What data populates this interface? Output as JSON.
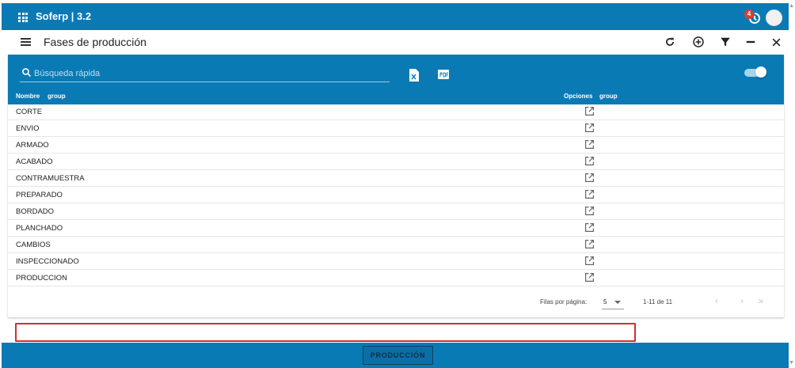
{
  "app": {
    "title": "Soferp | 3.2",
    "notification_count": "4",
    "accent_color": "#0a7ab5"
  },
  "header": {
    "title": "Fases de producción"
  },
  "toolbar": {
    "search_placeholder": "Búsqueda rápida",
    "excel_icon": "excel-export-icon",
    "pdf_icon": "pdf-export-icon"
  },
  "columns": {
    "name": "Nombre",
    "name_group": "group",
    "options": "Opciones",
    "options_group": "group"
  },
  "rows": [
    {
      "name": "CORTE"
    },
    {
      "name": "ENVIO"
    },
    {
      "name": "ARMADO"
    },
    {
      "name": "ACABADO"
    },
    {
      "name": "CONTRAMUESTRA"
    },
    {
      "name": "PREPARADO"
    },
    {
      "name": "BORDADO"
    },
    {
      "name": "PLANCHADO"
    },
    {
      "name": "CAMBIOS"
    },
    {
      "name": "INSPECCIONADO"
    },
    {
      "name": "PRODUCCION"
    }
  ],
  "pagination": {
    "rows_per_page_label": "Filas por página:",
    "rows_per_page_value": "5",
    "range": "1-11 de 11"
  },
  "footer": {
    "button_label": "PRODUCCIÓN"
  }
}
